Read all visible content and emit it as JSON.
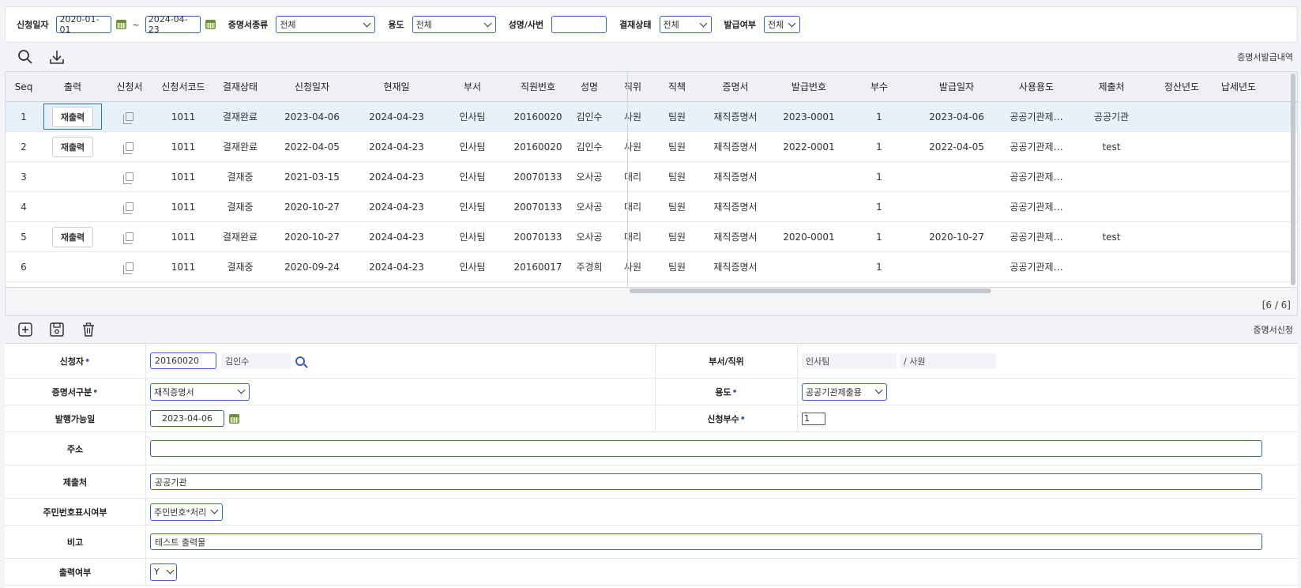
{
  "search": {
    "date_label": "신청일자",
    "date_from": "2020-01-01",
    "tilde": "~",
    "date_to": "2024-04-23",
    "cert_type_label": "증명서종류",
    "cert_type_value": "전체",
    "purpose_label": "용도",
    "purpose_value": "전체",
    "name_label": "성명/사번",
    "name_value": "",
    "approval_label": "결재상태",
    "approval_value": "전체",
    "issue_label": "발급여부",
    "issue_value": "전체"
  },
  "grid_toolbar": {
    "title": "증명서발급내역"
  },
  "grid": {
    "columns": [
      "Seq",
      "출력",
      "신청서",
      "신청서코드",
      "결재상태",
      "신청일자",
      "현재일",
      "부서",
      "직원번호",
      "성명",
      "직위",
      "직책",
      "증명서",
      "발급번호",
      "부수",
      "발급일자",
      "사용용도",
      "제출처",
      "정산년도",
      "납세년도"
    ],
    "rows": [
      {
        "seq": "1",
        "print": "재출력",
        "code": "1011",
        "status": "결재완료",
        "apply_date": "2023-04-06",
        "today": "2024-04-23",
        "dept": "인사팀",
        "emp_no": "20160020",
        "name": "김인수",
        "position": "사원",
        "duty": "팀원",
        "cert": "재직증명서",
        "issue_no": "2023-0001",
        "copies": "1",
        "issue_date": "2023-04-06",
        "usage": "공공기관제…",
        "submit": "공공기관",
        "settle": "",
        "tax": ""
      },
      {
        "seq": "2",
        "print": "재출력",
        "code": "1011",
        "status": "결재완료",
        "apply_date": "2022-04-05",
        "today": "2024-04-23",
        "dept": "인사팀",
        "emp_no": "20160020",
        "name": "김인수",
        "position": "사원",
        "duty": "팀원",
        "cert": "재직증명서",
        "issue_no": "2022-0001",
        "copies": "1",
        "issue_date": "2022-04-05",
        "usage": "공공기관제…",
        "submit": "test",
        "settle": "",
        "tax": ""
      },
      {
        "seq": "3",
        "print": "",
        "code": "1011",
        "status": "결재중",
        "apply_date": "2021-03-15",
        "today": "2024-04-23",
        "dept": "인사팀",
        "emp_no": "20070133",
        "name": "오사공",
        "position": "대리",
        "duty": "팀원",
        "cert": "재직증명서",
        "issue_no": "",
        "copies": "1",
        "issue_date": "",
        "usage": "공공기관제…",
        "submit": "",
        "settle": "",
        "tax": ""
      },
      {
        "seq": "4",
        "print": "",
        "code": "1011",
        "status": "결재중",
        "apply_date": "2020-10-27",
        "today": "2024-04-23",
        "dept": "인사팀",
        "emp_no": "20070133",
        "name": "오사공",
        "position": "대리",
        "duty": "팀원",
        "cert": "재직증명서",
        "issue_no": "",
        "copies": "1",
        "issue_date": "",
        "usage": "공공기관제…",
        "submit": "",
        "settle": "",
        "tax": ""
      },
      {
        "seq": "5",
        "print": "재출력",
        "code": "1011",
        "status": "결재완료",
        "apply_date": "2020-10-27",
        "today": "2024-04-23",
        "dept": "인사팀",
        "emp_no": "20070133",
        "name": "오사공",
        "position": "대리",
        "duty": "팀원",
        "cert": "재직증명서",
        "issue_no": "2020-0001",
        "copies": "1",
        "issue_date": "2020-10-27",
        "usage": "공공기관제…",
        "submit": "test",
        "settle": "",
        "tax": ""
      },
      {
        "seq": "6",
        "print": "",
        "code": "1011",
        "status": "결재중",
        "apply_date": "2020-09-24",
        "today": "2024-04-23",
        "dept": "인사팀",
        "emp_no": "20160017",
        "name": "주경희",
        "position": "사원",
        "duty": "팀원",
        "cert": "재직증명서",
        "issue_no": "",
        "copies": "1",
        "issue_date": "",
        "usage": "공공기관제…",
        "submit": "",
        "settle": "",
        "tax": ""
      }
    ],
    "count": "[6 / 6]"
  },
  "form_toolbar": {
    "title": "증명서신청"
  },
  "form": {
    "applicant_label": "신청자",
    "req_mark": "•",
    "emp_no": "20160020",
    "emp_name": "김인수",
    "dept_pos_label": "부서/직위",
    "dept": "인사팀",
    "pos_sep": "/ 사원",
    "cert_type_label": "증명서구분",
    "cert_type": "재직증명서",
    "purpose_label": "용도",
    "purpose": "공공기관제출용",
    "issue_date_label": "발행가능일",
    "issue_date": "2023-04-06",
    "copies_label": "신청부수",
    "copies": "1",
    "address_label": "주소",
    "address": "",
    "submit_label": "제출처",
    "submit": "공공기관",
    "rrn_label": "주민번호표시여부",
    "rrn": "주민번호*처리",
    "note_label": "비고",
    "note": "테스트 출력물",
    "print_label": "출력여부",
    "print": "Y"
  }
}
